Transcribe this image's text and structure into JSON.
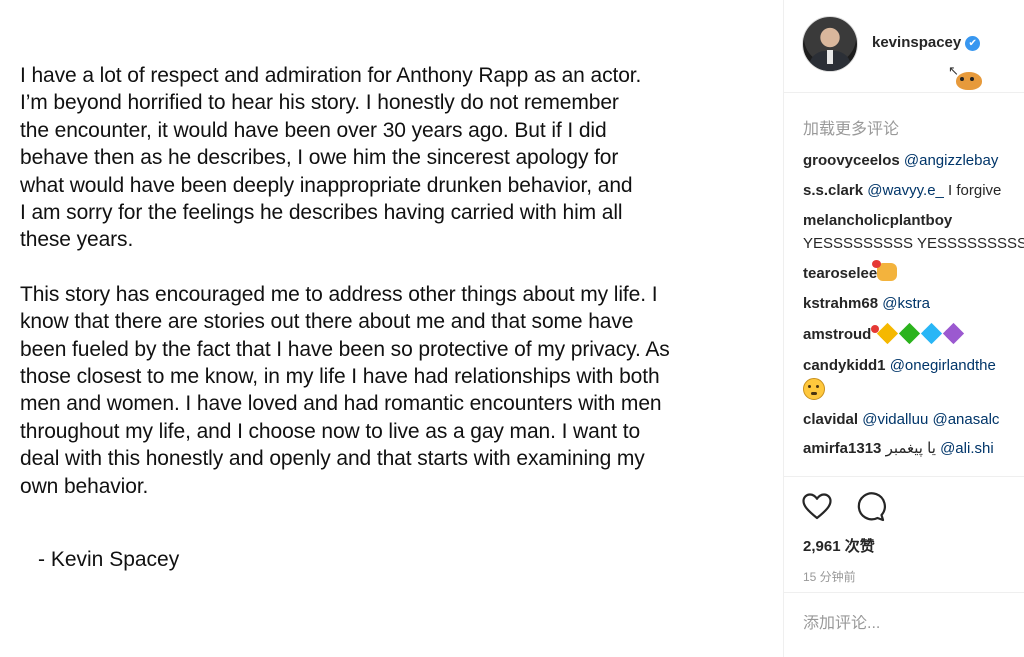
{
  "post": {
    "statement_paragraphs": [
      "I have a lot of respect and admiration for Anthony Rapp as an actor.\nI’m beyond horrified to hear his story. I honestly do not remember\nthe encounter, it would have been over 30 years ago. But if I did\nbehave then as he describes, I owe him the sincerest apology for\nwhat would have been deeply inappropriate drunken behavior, and\nI am sorry for the feelings he describes having carried with him all\nthese years.",
      "This story has encouraged me to address other things about my life. I\nknow that there are stories out there about me and that some have\nbeen fueled by the fact that I have been so protective of my privacy. As\nthose closest to me know, in my life I have had relationships with both\nmen and women. I have loved and had romantic encounters with men\nthroughout my life, and I choose now to live as a gay man.  I want to\ndeal with this honestly and openly and that starts with examining my\nown behavior."
    ],
    "signature": "- Kevin Spacey"
  },
  "header": {
    "username": "kevinspacey",
    "verified_icon": "verified-badge-icon",
    "verified_color": "#3897f0"
  },
  "comments": {
    "load_more_label": "加载更多评论",
    "items": [
      {
        "user": "groovyceelos",
        "mention": "@angizzlebay",
        "text": ""
      },
      {
        "user": "s.s.clark",
        "mention": "@wavyy.e_",
        "text": " I forgive"
      },
      {
        "user": "melancholicplantboy",
        "mention": "",
        "text": " YESSSSSSSSS YESSSSSSSSS"
      },
      {
        "user": "tearoselee",
        "mention": "",
        "text": ""
      },
      {
        "user": "kstrahm68",
        "mention": "@kstra",
        "text": ""
      },
      {
        "user": "amstroud",
        "mention": "",
        "text": ""
      },
      {
        "user": "candykidd1",
        "mention": "@onegirlandthe",
        "text": ""
      },
      {
        "user": "clavidal",
        "mention": "@vidalluu @anasalc",
        "text": ""
      },
      {
        "user": "amirfa1313",
        "mention": "@ali.shi",
        "text": " یا پیغمبر "
      }
    ],
    "emoji_names": [
      "raised-hands-with-heart-emoji",
      "yellow-heart-emoji",
      "green-heart-emoji",
      "blue-heart-emoji",
      "purple-heart-emoji",
      "flushed-face-emoji"
    ]
  },
  "actions": {
    "like_icon": "heart-outline-icon",
    "comment_icon": "speech-bubble-icon",
    "likes_label": "2,961 次赞",
    "timestamp": "15 分钟前"
  },
  "add_comment": {
    "placeholder": "添加评论..."
  }
}
